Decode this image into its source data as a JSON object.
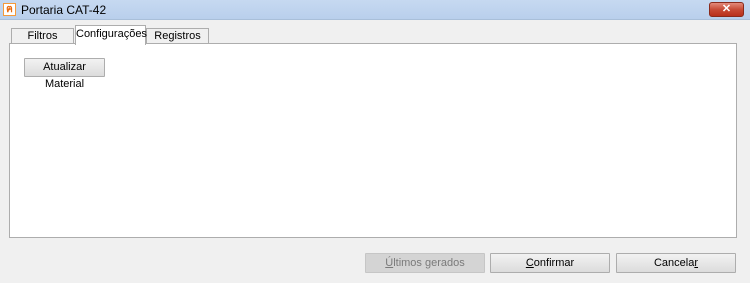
{
  "window": {
    "title": "Portaria CAT-42",
    "close_label": "✕"
  },
  "tabs": [
    {
      "label": "Filtros",
      "active": false
    },
    {
      "label": "Configurações",
      "active": true
    },
    {
      "label": "Registros",
      "active": false
    }
  ],
  "panel": {
    "update_button_label": "Atualizar Material"
  },
  "footer": {
    "ultimos_first": "Ú",
    "ultimos_rest": "ltimos gerados",
    "confirmar_first": "C",
    "confirmar_rest": "onfirmar",
    "cancelar_start": "Cancela",
    "cancelar_ul": "r"
  }
}
